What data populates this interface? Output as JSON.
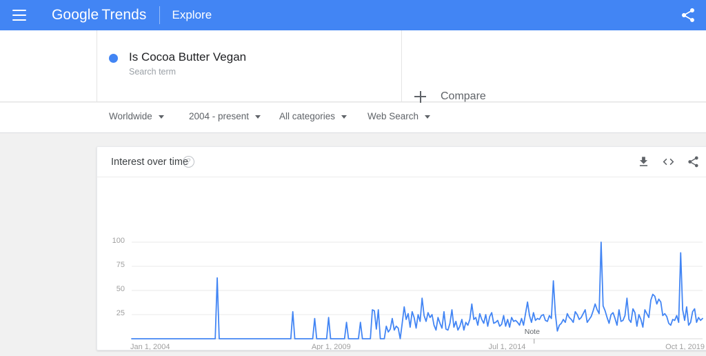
{
  "header": {
    "menu_icon": "hamburger-menu-icon",
    "brand_google": "Google",
    "brand_product": "Trends",
    "explore_label": "Explore",
    "share_icon": "share-icon",
    "bg_color": "#4285f4"
  },
  "search_term": {
    "dot_color": "#4285f4",
    "title": "Is Cocoa Butter Vegan",
    "subtitle": "Search term"
  },
  "compare": {
    "plus_icon": "plus-icon",
    "label": "Compare"
  },
  "filters": [
    {
      "label": "Worldwide",
      "caret_icon": "chevron-down-icon"
    },
    {
      "label": "2004 - present",
      "caret_icon": "chevron-down-icon"
    },
    {
      "label": "All categories",
      "caret_icon": "chevron-down-icon"
    },
    {
      "label": "Web Search",
      "caret_icon": "chevron-down-icon"
    }
  ],
  "card": {
    "title": "Interest over time",
    "help_icon": "question-mark-icon",
    "help_glyph": "?",
    "actions": [
      {
        "name": "download-icon"
      },
      {
        "name": "embed-code-icon"
      },
      {
        "name": "share-icon"
      }
    ]
  },
  "chart_data": {
    "type": "line",
    "title": "Interest over time",
    "xlabel": "",
    "ylabel": "",
    "ylim": [
      0,
      100
    ],
    "yticks": [
      25,
      50,
      75,
      100
    ],
    "ytick_labels": [
      "25",
      "50",
      "75",
      "100"
    ],
    "xtick_labels": [
      "Jan 1, 2004",
      "Apr 1, 2009",
      "Jul 1, 2014",
      "Oct 1, 2019"
    ],
    "xtick_positions": [
      0,
      0.315,
      0.625,
      0.935
    ],
    "grid": true,
    "legend": "none",
    "line_color": "#4285f4",
    "line_width": 1.8,
    "annotations": [
      {
        "label": "Note",
        "x_fraction": 0.705
      }
    ],
    "series": [
      {
        "name": "Is Cocoa Butter Vegan",
        "color": "#4285f4",
        "values": [
          0,
          0,
          0,
          0,
          0,
          0,
          0,
          0,
          0,
          0,
          0,
          0,
          0,
          0,
          0,
          0,
          0,
          0,
          0,
          0,
          0,
          0,
          0,
          0,
          0,
          0,
          0,
          0,
          0,
          0,
          0,
          0,
          0,
          0,
          0,
          0,
          0,
          0,
          0,
          0,
          0,
          0,
          0,
          63,
          0,
          0,
          0,
          0,
          0,
          0,
          0,
          0,
          0,
          0,
          0,
          0,
          0,
          0,
          0,
          0,
          0,
          0,
          0,
          0,
          0,
          0,
          0,
          0,
          0,
          0,
          0,
          0,
          0,
          0,
          0,
          0,
          0,
          0,
          0,
          0,
          0,
          28,
          0,
          0,
          0,
          0,
          0,
          0,
          0,
          0,
          0,
          0,
          21,
          0,
          0,
          0,
          0,
          0,
          0,
          22,
          0,
          0,
          0,
          0,
          0,
          0,
          0,
          0,
          17,
          0,
          0,
          0,
          0,
          0,
          0,
          17,
          0,
          0,
          0,
          0,
          0,
          30,
          29,
          10,
          30,
          0,
          0,
          0,
          13,
          7,
          10,
          21,
          9,
          13,
          11,
          0,
          16,
          33,
          20,
          26,
          12,
          28,
          22,
          11,
          25,
          18,
          42,
          24,
          18,
          27,
          22,
          25,
          14,
          9,
          22,
          16,
          11,
          28,
          10,
          9,
          16,
          30,
          12,
          18,
          9,
          13,
          20,
          9,
          17,
          14,
          20,
          36,
          20,
          22,
          14,
          26,
          20,
          16,
          25,
          13,
          23,
          27,
          16,
          17,
          19,
          13,
          15,
          24,
          13,
          20,
          12,
          22,
          18,
          19,
          17,
          14,
          21,
          14,
          26,
          38,
          24,
          17,
          27,
          19,
          21,
          20,
          24,
          25,
          19,
          18,
          24,
          21,
          60,
          26,
          8,
          14,
          16,
          20,
          17,
          26,
          22,
          20,
          17,
          28,
          25,
          20,
          22,
          26,
          30,
          17,
          20,
          23,
          29,
          36,
          30,
          26,
          100,
          34,
          29,
          22,
          16,
          25,
          27,
          21,
          14,
          30,
          18,
          19,
          24,
          42,
          20,
          17,
          31,
          27,
          13,
          25,
          20,
          12,
          30,
          26,
          22,
          40,
          46,
          44,
          36,
          41,
          38,
          24,
          26,
          23,
          16,
          14,
          20,
          19,
          24,
          17,
          89,
          30,
          19,
          33,
          14,
          17,
          28,
          31,
          17,
          22,
          19,
          21
        ]
      }
    ]
  }
}
